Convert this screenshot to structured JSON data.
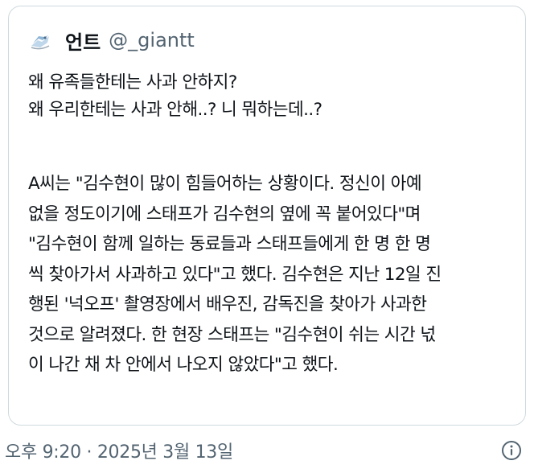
{
  "quote": {
    "author": {
      "display_name": "언트",
      "handle": "@_giantt",
      "avatar_icon": "bird-avatar-icon"
    },
    "lines_para1": [
      "왜 유족들한테는 사과 안하지?",
      "왜 우리한테는 사과 안해..? 니 뭐하는데..?"
    ],
    "lines_para2": [
      "A씨는 \"김수현이 많이 힘들어하는 상황이다. 정신이 아예",
      "없을 정도이기에 스태프가 김수현의 옆에 꼭 붙어있다\"며",
      "\"김수현이 함께 일하는 동료들과 스태프들에게 한 명 한 명",
      "씩 찾아가서 사과하고 있다\"고 했다. 김수현은 지난 12일 진",
      "행된 '넉오프' 촬영장에서 배우진, 감독진을 찾아가 사과한",
      "것으로 알려졌다. 한 현장 스태프는 \"김수현이 쉬는 시간 넋",
      "이 나간 채 차 안에서 나오지 않았다\"고 했다."
    ]
  },
  "footer": {
    "timestamp": "오후 9:20 · 2025년 3월 13일",
    "info_icon": "info-icon"
  },
  "colors": {
    "text": "#0f1419",
    "secondary": "#536471",
    "border": "#cfd9de"
  }
}
